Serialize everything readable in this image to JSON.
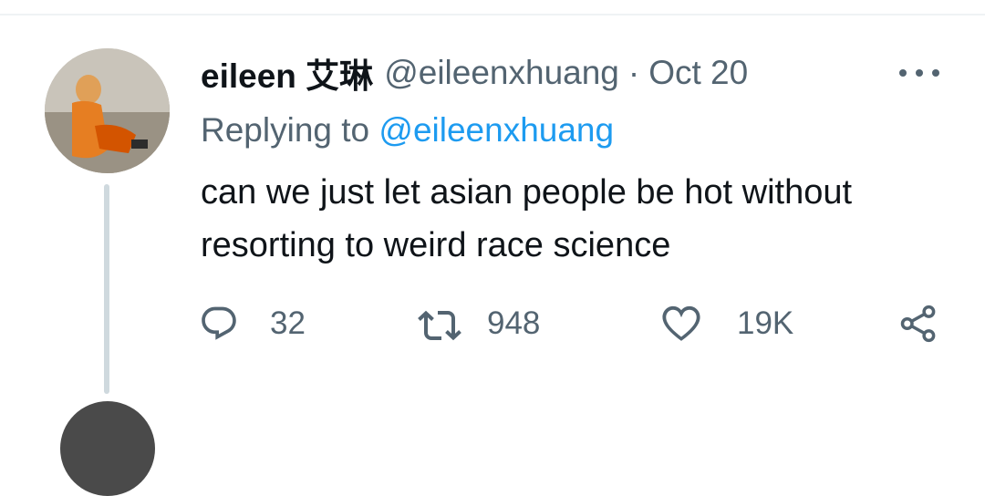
{
  "tweet": {
    "display_name": "eileen 艾琳",
    "handle": "@eileenxhuang",
    "separator": "·",
    "date": "Oct 20",
    "reply_prefix": "Replying to",
    "reply_to": "@eileenxhuang",
    "text": "can we just let asian people be hot without resorting to weird race science"
  },
  "actions": {
    "reply": {
      "icon": "reply-icon",
      "count": "32"
    },
    "retweet": {
      "icon": "retweet-icon",
      "count": "948"
    },
    "like": {
      "icon": "heart-icon",
      "count": "19K"
    },
    "share": {
      "icon": "share-icon"
    }
  },
  "colors": {
    "text_primary": "#0f1419",
    "text_secondary": "#536471",
    "link": "#1d9bf0",
    "thread_line": "#cfd9de"
  }
}
